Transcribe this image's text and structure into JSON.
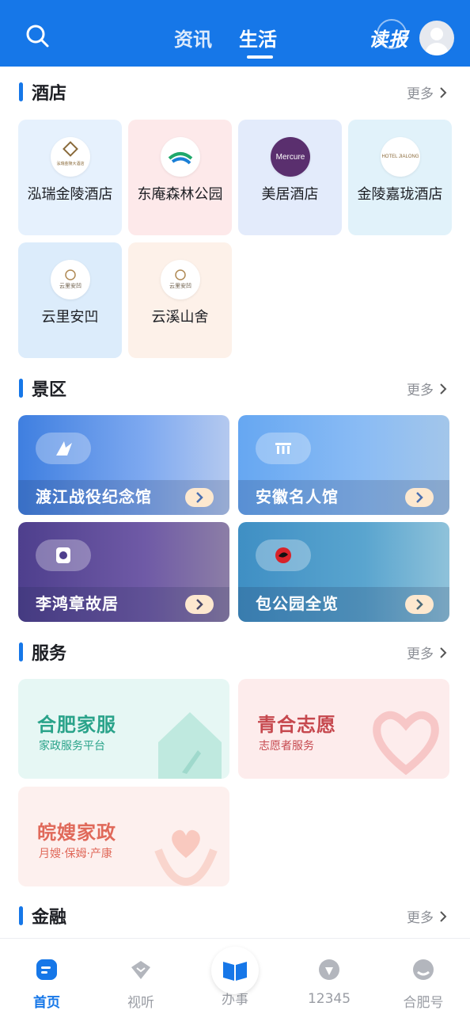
{
  "header": {
    "tabs": [
      {
        "label": "资讯",
        "active": false
      },
      {
        "label": "生活",
        "active": true
      }
    ],
    "dubao_label": "读报"
  },
  "sections": {
    "hotel": {
      "title": "酒店",
      "more": "更多",
      "items": [
        {
          "name": "泓瑞金陵酒店",
          "bg": "#e6f1fd",
          "logo_text": "泓瑞金陵大酒店"
        },
        {
          "name": "东庵森林公园",
          "bg": "#fde9ea",
          "logo_text": ""
        },
        {
          "name": "美居酒店",
          "bg": "#e3ebfb",
          "logo_text": "Mercure"
        },
        {
          "name": "金陵嘉珑酒店",
          "bg": "#e1f2fa",
          "logo_text": "HOTEL JIALONG"
        },
        {
          "name": "云里安凹",
          "bg": "#dcecfb",
          "logo_text": "云里安凹"
        },
        {
          "name": "云溪山舍",
          "bg": "#fdf1e9",
          "logo_text": "云里安凹"
        }
      ]
    },
    "scenic": {
      "title": "景区",
      "more": "更多",
      "items": [
        {
          "name": "渡江战役纪念馆",
          "bg": "linear-gradient(90deg,#3f7fe0,#7ea9f0 60%,#b4c9ef)"
        },
        {
          "name": "安徽名人馆",
          "bg": "linear-gradient(90deg,#66a7f2,#8bbcf4 60%,#a3c6ea)"
        },
        {
          "name": "李鸿章故居",
          "bg": "linear-gradient(90deg,#4e3f8d,#6f5aa6 60%,#8c7ea6)"
        },
        {
          "name": "包公园全览",
          "bg": "linear-gradient(90deg,#3f8fc4,#5aa5cf 60%,#8fc2da)"
        }
      ]
    },
    "service": {
      "title": "服务",
      "more": "更多",
      "items": [
        {
          "title": "合肥家服",
          "sub": "家政服务平台",
          "color": "#2aa38a",
          "bg": "#e6f7f4"
        },
        {
          "title": "青合志愿",
          "sub": "志愿者服务",
          "color": "#c6484e",
          "bg": "#fdecec"
        },
        {
          "title": "皖嫂家政",
          "sub": "月嫂·保姆·产康",
          "color": "#e0695a",
          "bg": "#fdf0ee"
        }
      ]
    },
    "finance": {
      "title": "金融",
      "more": "更多"
    }
  },
  "bottom_nav": [
    {
      "label": "首页",
      "active": true
    },
    {
      "label": "视听",
      "active": false
    },
    {
      "label": "办事",
      "active": false
    },
    {
      "label": "12345",
      "active": false
    },
    {
      "label": "合肥号",
      "active": false
    }
  ],
  "colors": {
    "primary": "#1677e8",
    "text": "#1d1f24",
    "muted": "#8c8f96"
  }
}
